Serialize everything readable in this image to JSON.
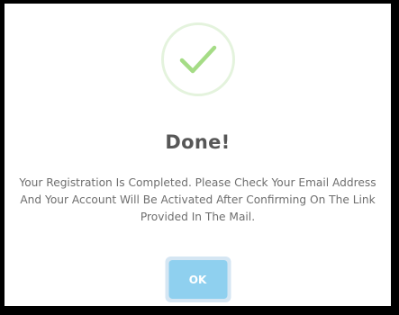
{
  "dialog": {
    "icon": "checkmark-icon",
    "title": "Done!",
    "message": "Your Registration Is Completed. Please Check Your Email Address And Your Account Will Be Activated After Confirming On The Link Provided In The Mail.",
    "ok_label": "OK"
  },
  "colors": {
    "check": "#a5dc86",
    "circle_border": "#e4f3dd",
    "button": "#8fd0ef",
    "button_focus_ring": "#d5e6f3",
    "title_text": "#575757",
    "message_text": "#6e6e6e"
  }
}
